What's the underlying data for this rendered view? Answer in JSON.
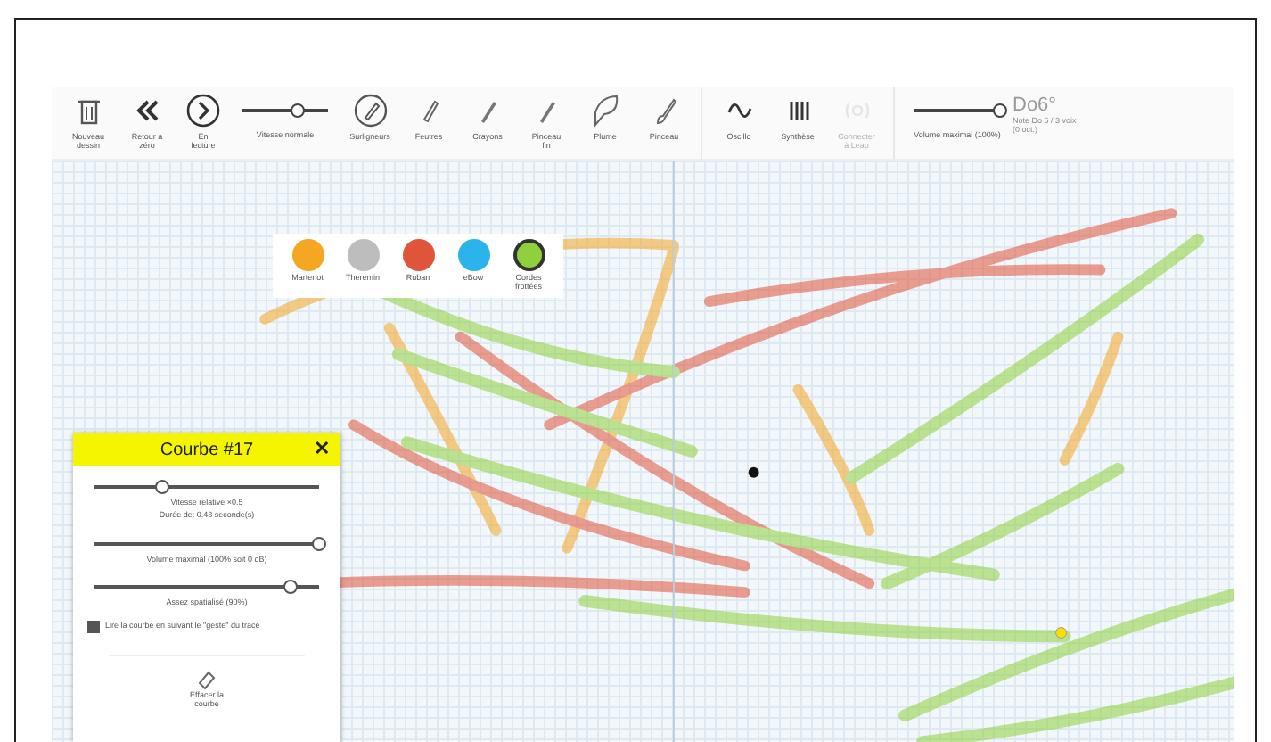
{
  "toolbar": [
    {
      "kind": "trash",
      "label": "Nouveau dessin",
      "disabled": false
    },
    {
      "kind": "rewind",
      "label": "Retour à zéro",
      "disabled": false
    },
    {
      "kind": "play",
      "label": "En lecture",
      "disabled": false
    },
    {
      "kind": "slider",
      "label": "Vitesse normale",
      "level": 0.65,
      "disabled": false
    },
    {
      "kind": "highlighter",
      "label": "Surligneurs",
      "disabled": false
    },
    {
      "kind": "marker",
      "label": "Feutres",
      "disabled": false
    },
    {
      "kind": "pencil",
      "label": "Crayons",
      "disabled": false
    },
    {
      "kind": "pencil",
      "label": "Pinceau fin",
      "disabled": false
    },
    {
      "kind": "nib",
      "label": "Plume",
      "disabled": false
    },
    {
      "kind": "brush",
      "label": "Pinceau",
      "disabled": false
    },
    {
      "kind": "separator"
    },
    {
      "kind": "wave",
      "label": "Oscillo",
      "disabled": false
    },
    {
      "kind": "synth",
      "label": "Synthèse",
      "disabled": false
    },
    {
      "kind": "sensor",
      "label": "Connecter à Leap",
      "disabled": true
    },
    {
      "kind": "separator"
    },
    {
      "kind": "slider",
      "label": "Volume maximal (100%)",
      "level": 1,
      "disabled": false
    },
    {
      "kind": "note",
      "label": "Do6°",
      "sub": "Note Do 6 / 3 voix (0 oct.)",
      "disabled": true
    }
  ],
  "palette": [
    {
      "label": "Martenot",
      "color": "#f5a623",
      "selected": false
    },
    {
      "label": "Theremin",
      "color": "#bdbdbd",
      "selected": false
    },
    {
      "label": "Ruban",
      "color": "#e0553a",
      "selected": false
    },
    {
      "label": "eBow",
      "color": "#2bb3ec",
      "selected": false
    },
    {
      "label": "Cordes frottées",
      "color": "#8fd13c",
      "selected": true
    }
  ],
  "panel": {
    "title": "Courbe #17",
    "close": "✕",
    "sliders": [
      {
        "level": 0.3,
        "lines": [
          "Vitesse relative ×0.5",
          "Durée de: 0.43 seconde(s)"
        ]
      },
      {
        "level": 1,
        "lines": [
          "Volume maximal (100% soit 0 dB)"
        ]
      },
      {
        "level": 0.87,
        "lines": [
          "Assez spatialisé (90%)"
        ]
      }
    ],
    "checkbox": {
      "label": "Lire la courbe en suivant le \"geste\" du tracé",
      "checked": true
    },
    "erase": "Effacer la courbe"
  }
}
